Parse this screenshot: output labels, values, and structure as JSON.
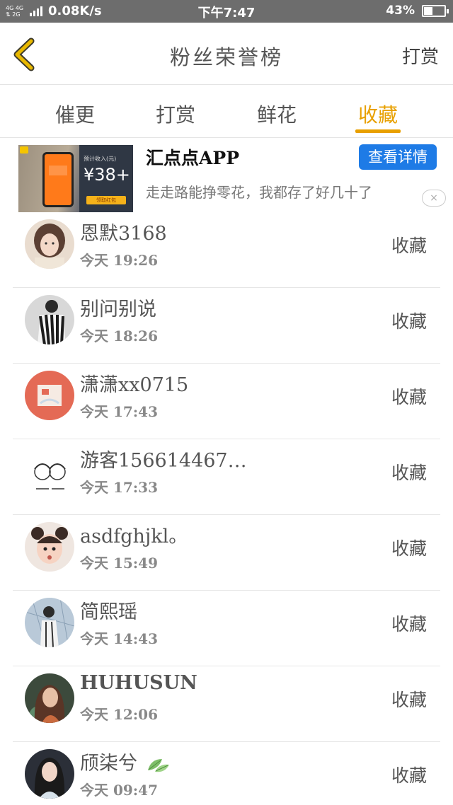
{
  "status_bar": {
    "network_top": "4G 4G",
    "network_bottom": "⇅ 2G",
    "speed": "0.08K/s",
    "time": "下午7:47",
    "battery_percent": "43%",
    "battery_level": 0.43,
    "text_color": "#ffffff",
    "background": "#6d6d6d"
  },
  "header": {
    "back_icon": "chevron-left-icon",
    "back_icon_color": "#e8b800",
    "title": "粉丝荣誉榜",
    "action": "打赏"
  },
  "tabs": {
    "items": [
      {
        "label": "催更",
        "active": false
      },
      {
        "label": "打赏",
        "active": false
      },
      {
        "label": "鲜花",
        "active": false
      },
      {
        "label": "收藏",
        "active": true
      }
    ],
    "active_color": "#e8a000"
  },
  "ad": {
    "image_text_label": "预计收入(元)",
    "image_amount": "¥38+",
    "image_button": "领取红包",
    "title": "汇点点APP",
    "description": "走走路能挣零花，我都存了好几十了",
    "cta": "查看详情",
    "cta_color": "#1e7be6",
    "close_icon": "close-icon",
    "close_symbol": "×"
  },
  "list": [
    {
      "name": "恩默3168",
      "time": "今天 19:26",
      "action": "收藏"
    },
    {
      "name": "别问别说",
      "time": "今天 18:26",
      "action": "收藏"
    },
    {
      "name": "潇潇xx0715",
      "time": "今天 17:43",
      "action": "收藏"
    },
    {
      "name": "游客156614467…",
      "time": "今天 17:33",
      "action": "收藏"
    },
    {
      "name": "asdfghjkl。",
      "time": "今天 15:49",
      "action": "收藏"
    },
    {
      "name": "简熙瑶",
      "time": "今天 14:43",
      "action": "收藏"
    },
    {
      "name": "HUHUSUN",
      "time": "今天 12:06",
      "action": "收藏"
    },
    {
      "name": "颀柒兮",
      "time": "今天 09:47",
      "action": "收藏",
      "emoji_icon": "leaves-icon"
    }
  ]
}
